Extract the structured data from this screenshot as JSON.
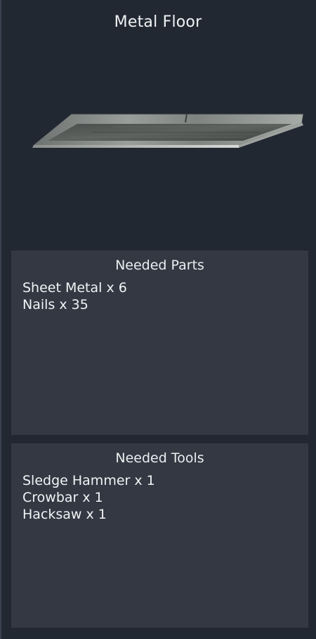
{
  "item": {
    "title": "Metal Floor"
  },
  "parts_panel": {
    "title": "Needed Parts",
    "items": [
      {
        "text": "Sheet Metal x 6"
      },
      {
        "text": "Nails x 35"
      }
    ]
  },
  "tools_panel": {
    "title": "Needed Tools",
    "items": [
      {
        "text": "Sledge Hammer x 1"
      },
      {
        "text": "Crowbar x 1"
      },
      {
        "text": "Hacksaw x 1"
      }
    ]
  }
}
